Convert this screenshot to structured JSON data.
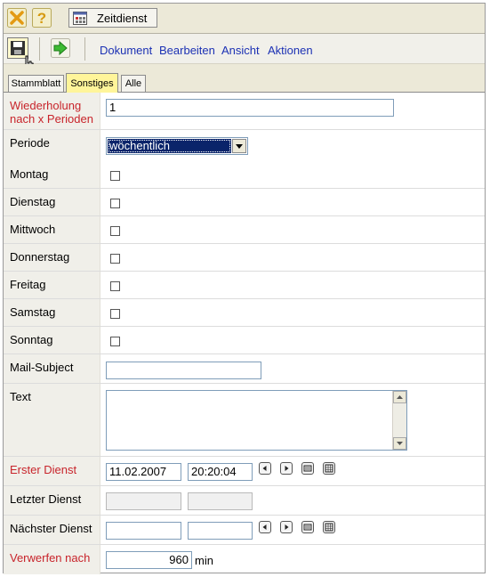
{
  "window": {
    "title": "Zeitdienst"
  },
  "toolbar": {
    "menu": [
      "Dokument",
      "Bearbeiten",
      "Ansicht",
      "Aktionen"
    ]
  },
  "tabs": [
    "Stammblatt",
    "Sonstiges",
    "Alle"
  ],
  "active_tab": "Sonstiges",
  "form": {
    "wiederholung": {
      "label": "Wiederholung nach x Perioden",
      "value": "1"
    },
    "periode": {
      "label": "Periode",
      "value": "wöchentlich"
    },
    "days": [
      {
        "label": "Montag",
        "checked": false
      },
      {
        "label": "Dienstag",
        "checked": false
      },
      {
        "label": "Mittwoch",
        "checked": false
      },
      {
        "label": "Donnerstag",
        "checked": false
      },
      {
        "label": "Freitag",
        "checked": false
      },
      {
        "label": "Samstag",
        "checked": false
      },
      {
        "label": "Sonntag",
        "checked": false
      }
    ],
    "mail_subject": {
      "label": "Mail-Subject",
      "value": ""
    },
    "text": {
      "label": "Text",
      "value": ""
    },
    "erster_dienst": {
      "label": "Erster Dienst",
      "date": "11.02.2007",
      "time": "20:20:04"
    },
    "letzter_dienst": {
      "label": "Letzter Dienst",
      "date": "",
      "time": ""
    },
    "naechster_dienst": {
      "label": "Nächster Dienst",
      "date": "",
      "time": ""
    },
    "verwerfen": {
      "label": "Verwerfen nach",
      "value": "960",
      "unit": "min"
    }
  },
  "colors": {
    "required_label": "#c8242b",
    "menu_link": "#1c31b4",
    "active_tab": "#fff59a"
  }
}
